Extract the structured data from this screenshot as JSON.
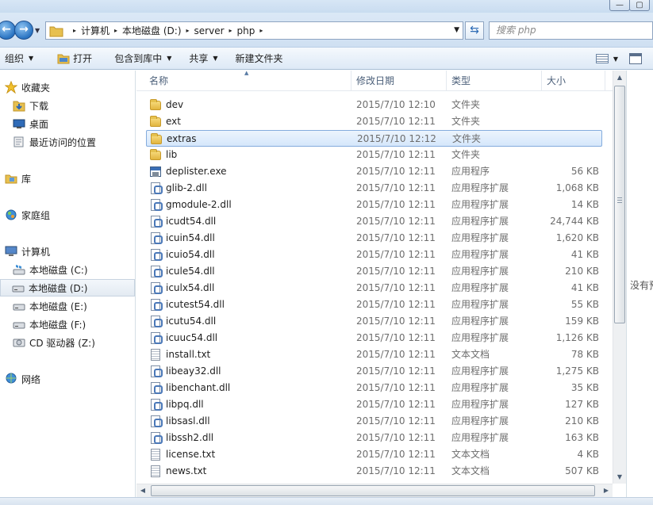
{
  "window": {
    "min_glyph": "—",
    "max_glyph": "▢"
  },
  "address": {
    "crumbs": [
      "计算机",
      "本地磁盘 (D:)",
      "server",
      "php"
    ],
    "separator": "▸",
    "search_placeholder": "搜索 php"
  },
  "toolbar": {
    "organize": "组织",
    "open": "打开",
    "include_in_library": "包含到库中",
    "share": "共享",
    "new_folder": "新建文件夹"
  },
  "nav": {
    "favorites": "收藏夹",
    "downloads": "下载",
    "desktop": "桌面",
    "recent": "最近访问的位置",
    "libraries": "库",
    "homegroup": "家庭组",
    "computer": "计算机",
    "drive_c": "本地磁盘 (C:)",
    "drive_d": "本地磁盘 (D:)",
    "drive_e": "本地磁盘 (E:)",
    "drive_f": "本地磁盘 (F:)",
    "drive_z": "CD 驱动器 (Z:)",
    "network": "网络",
    "selected": "drive_d"
  },
  "columns": {
    "name": "名称",
    "date": "修改日期",
    "type": "类型",
    "size": "大小"
  },
  "files": [
    {
      "name": "dev",
      "date": "2015/7/10 12:10",
      "type": "文件夹",
      "size": "",
      "icon": "folder-icon"
    },
    {
      "name": "ext",
      "date": "2015/7/10 12:11",
      "type": "文件夹",
      "size": "",
      "icon": "folder-icon"
    },
    {
      "name": "extras",
      "date": "2015/7/10 12:12",
      "type": "文件夹",
      "size": "",
      "icon": "folder-icon",
      "selected": true
    },
    {
      "name": "lib",
      "date": "2015/7/10 12:11",
      "type": "文件夹",
      "size": "",
      "icon": "folder-icon"
    },
    {
      "name": "deplister.exe",
      "date": "2015/7/10 12:11",
      "type": "应用程序",
      "size": "56 KB",
      "icon": "exe-icon"
    },
    {
      "name": "glib-2.dll",
      "date": "2015/7/10 12:11",
      "type": "应用程序扩展",
      "size": "1,068 KB",
      "icon": "dll-icon"
    },
    {
      "name": "gmodule-2.dll",
      "date": "2015/7/10 12:11",
      "type": "应用程序扩展",
      "size": "14 KB",
      "icon": "dll-icon"
    },
    {
      "name": "icudt54.dll",
      "date": "2015/7/10 12:11",
      "type": "应用程序扩展",
      "size": "24,744 KB",
      "icon": "dll-icon"
    },
    {
      "name": "icuin54.dll",
      "date": "2015/7/10 12:11",
      "type": "应用程序扩展",
      "size": "1,620 KB",
      "icon": "dll-icon"
    },
    {
      "name": "icuio54.dll",
      "date": "2015/7/10 12:11",
      "type": "应用程序扩展",
      "size": "41 KB",
      "icon": "dll-icon"
    },
    {
      "name": "icule54.dll",
      "date": "2015/7/10 12:11",
      "type": "应用程序扩展",
      "size": "210 KB",
      "icon": "dll-icon"
    },
    {
      "name": "iculx54.dll",
      "date": "2015/7/10 12:11",
      "type": "应用程序扩展",
      "size": "41 KB",
      "icon": "dll-icon"
    },
    {
      "name": "icutest54.dll",
      "date": "2015/7/10 12:11",
      "type": "应用程序扩展",
      "size": "55 KB",
      "icon": "dll-icon"
    },
    {
      "name": "icutu54.dll",
      "date": "2015/7/10 12:11",
      "type": "应用程序扩展",
      "size": "159 KB",
      "icon": "dll-icon"
    },
    {
      "name": "icuuc54.dll",
      "date": "2015/7/10 12:11",
      "type": "应用程序扩展",
      "size": "1,126 KB",
      "icon": "dll-icon"
    },
    {
      "name": "install.txt",
      "date": "2015/7/10 12:11",
      "type": "文本文档",
      "size": "78 KB",
      "icon": "text-file-icon"
    },
    {
      "name": "libeay32.dll",
      "date": "2015/7/10 12:11",
      "type": "应用程序扩展",
      "size": "1,275 KB",
      "icon": "dll-icon"
    },
    {
      "name": "libenchant.dll",
      "date": "2015/7/10 12:11",
      "type": "应用程序扩展",
      "size": "35 KB",
      "icon": "dll-icon"
    },
    {
      "name": "libpq.dll",
      "date": "2015/7/10 12:11",
      "type": "应用程序扩展",
      "size": "127 KB",
      "icon": "dll-icon"
    },
    {
      "name": "libsasl.dll",
      "date": "2015/7/10 12:11",
      "type": "应用程序扩展",
      "size": "210 KB",
      "icon": "dll-icon"
    },
    {
      "name": "libssh2.dll",
      "date": "2015/7/10 12:11",
      "type": "应用程序扩展",
      "size": "163 KB",
      "icon": "dll-icon"
    },
    {
      "name": "license.txt",
      "date": "2015/7/10 12:11",
      "type": "文本文档",
      "size": "4 KB",
      "icon": "text-file-icon"
    },
    {
      "name": "news.txt",
      "date": "2015/7/10 12:11",
      "type": "文本文档",
      "size": "507 KB",
      "icon": "text-file-icon"
    }
  ],
  "preview": {
    "text": "没有预"
  },
  "colors": {
    "selection_bg": "#d5e7fb",
    "selection_border": "#84acdd",
    "muted_text": "#6d6d6d"
  }
}
